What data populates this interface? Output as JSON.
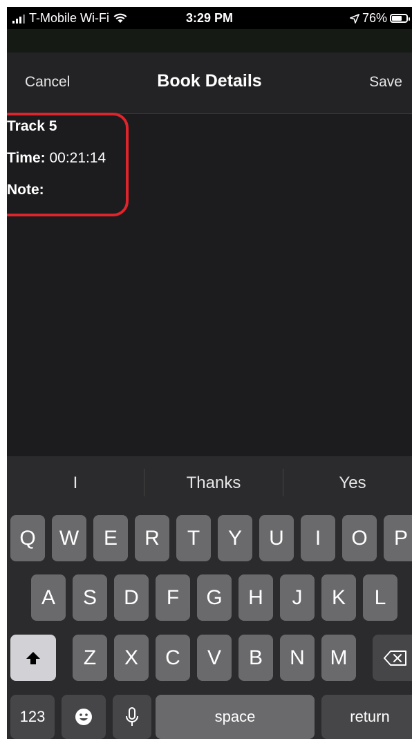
{
  "status_bar": {
    "carrier": "T-Mobile Wi-Fi",
    "time": "3:29 PM",
    "battery": "76%",
    "battery_level": 0.76
  },
  "nav": {
    "cancel": "Cancel",
    "title": "Book Details",
    "save": "Save"
  },
  "details": {
    "track": "Track 5",
    "time_label": "Time:",
    "time_value": "00:21:14",
    "note_label": "Note:"
  },
  "keyboard": {
    "suggestions": [
      "I",
      "Thanks",
      "Yes"
    ],
    "row1": [
      "Q",
      "W",
      "E",
      "R",
      "T",
      "Y",
      "U",
      "I",
      "O",
      "P"
    ],
    "row2": [
      "A",
      "S",
      "D",
      "F",
      "G",
      "H",
      "J",
      "K",
      "L"
    ],
    "row3": [
      "Z",
      "X",
      "C",
      "V",
      "B",
      "N",
      "M"
    ],
    "numbers": "123",
    "space": "space",
    "return": "return",
    "icons": {
      "shift": "shift-icon",
      "backspace": "backspace-icon",
      "emoji": "emoji-icon",
      "mic": "microphone-icon"
    }
  },
  "colors": {
    "highlight": "#e0242b",
    "background": "#1c1c1e",
    "key": "#6a6a6c"
  }
}
